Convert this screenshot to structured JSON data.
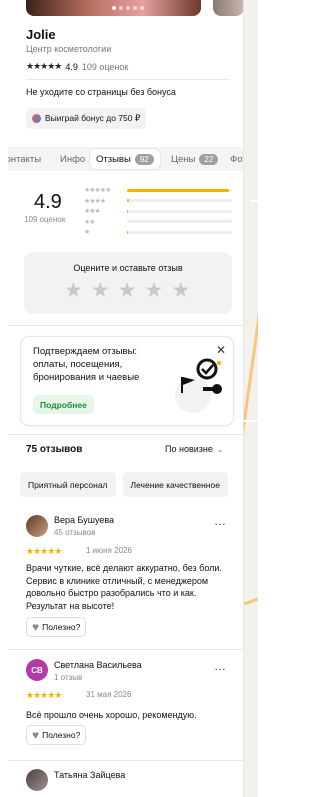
{
  "business": {
    "name": "Jolie",
    "category": "Центр косметологии",
    "rating": "4.9",
    "reviews_count": "109 оценок",
    "leave_text": "Не уходите со страницы без бонуса",
    "bonus_label": "Выиграй бонус до 750 ₽"
  },
  "tabs": [
    {
      "label": "Контакты"
    },
    {
      "label": "Инфо"
    },
    {
      "label": "Отзывы",
      "badge": "92"
    },
    {
      "label": "Цены",
      "badge": "22"
    },
    {
      "label": "Фото"
    }
  ],
  "summary": {
    "rating": "4.9",
    "count": "109 оценок",
    "bar_fractions": [
      0.97,
      0.02,
      0.01,
      0.0,
      0.01
    ],
    "star_labels": [
      "★★★★★",
      "★★★★",
      "★★★",
      "★★",
      "★"
    ]
  },
  "rate_box": {
    "title": "Оцените и оставьте отзыв",
    "stars": [
      "★",
      "★",
      "★",
      "★",
      "★"
    ]
  },
  "confirm": {
    "text": "Подтверждаем отзывы: оплаты, посещения, бронирования и чаевые",
    "more_label": "Подробнее",
    "close": "✕"
  },
  "list": {
    "count": "75 отзывов",
    "sort": "По новизне",
    "chips": [
      "Приятный персонал",
      "Лечение качественное"
    ]
  },
  "reviews": [
    {
      "name": "Вера Бушуева",
      "sub": "45 отзывов",
      "stars": "★★★★★",
      "date": "1 июня 2026",
      "text": "Врачи чуткие, всё делают аккуратно, без боли. Сервис в клинике отличный, с менеджером довольно быстро разобрались что и как. Результат на высоте!",
      "useful": "Полезно?"
    },
    {
      "name": "Светлана Васильева",
      "initials": "СВ",
      "sub": "1 отзыв",
      "stars": "★★★★★",
      "date": "31 мая 2026",
      "text": "Всё прошло очень хорошо, рекомендую.",
      "useful": "Полезно?"
    },
    {
      "name": "Татьяна Зайцева"
    }
  ],
  "menu_dots": "…",
  "colors": {
    "accent_star": "#f3b400",
    "avatar_sv": "#b43aa8",
    "green": "#1a8f3a"
  }
}
